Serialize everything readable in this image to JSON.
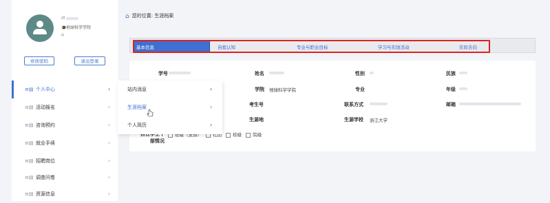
{
  "user": {
    "school": "地球科学学院"
  },
  "buttons": {
    "change_password": "修改密码",
    "logout": "退出登录"
  },
  "nav": {
    "items": [
      {
        "label": "个人中心"
      },
      {
        "label": "活动报名"
      },
      {
        "label": "咨询预约"
      },
      {
        "label": "就业手续"
      },
      {
        "label": "招聘岗位"
      },
      {
        "label": "调查问卷"
      },
      {
        "label": "资源信息"
      }
    ]
  },
  "submenu": {
    "items": [
      {
        "label": "站内消息"
      },
      {
        "label": "生涯档案"
      },
      {
        "label": "个人简历"
      }
    ]
  },
  "breadcrumb": {
    "prefix": "您的位置:",
    "current": "生涯档案"
  },
  "tabs": [
    {
      "label": "基本信息"
    },
    {
      "label": "自我认知"
    },
    {
      "label": "专业与职业目标"
    },
    {
      "label": "学习与实践活动"
    },
    {
      "label": "实际去向"
    }
  ],
  "form": {
    "student_id_label": "学号",
    "name_label": "姓名",
    "gender_label": "性别",
    "ethnicity_label": "民族",
    "college_label": "学院",
    "college_value": "地球科学学院",
    "major_label": "专业",
    "grade_label": "年级",
    "exam_no_label": "考生号",
    "contact_label": "联系方式",
    "email_label": "邮箱",
    "origin_label": "生源地",
    "origin_school_label": "生源学校",
    "origin_school_value": "浙江大学",
    "cadre_label_1": "担任学生干",
    "cadre_label_2": "部情况",
    "cadre_options": [
      "班级（支部）",
      "社团",
      "校级",
      "院级"
    ]
  }
}
